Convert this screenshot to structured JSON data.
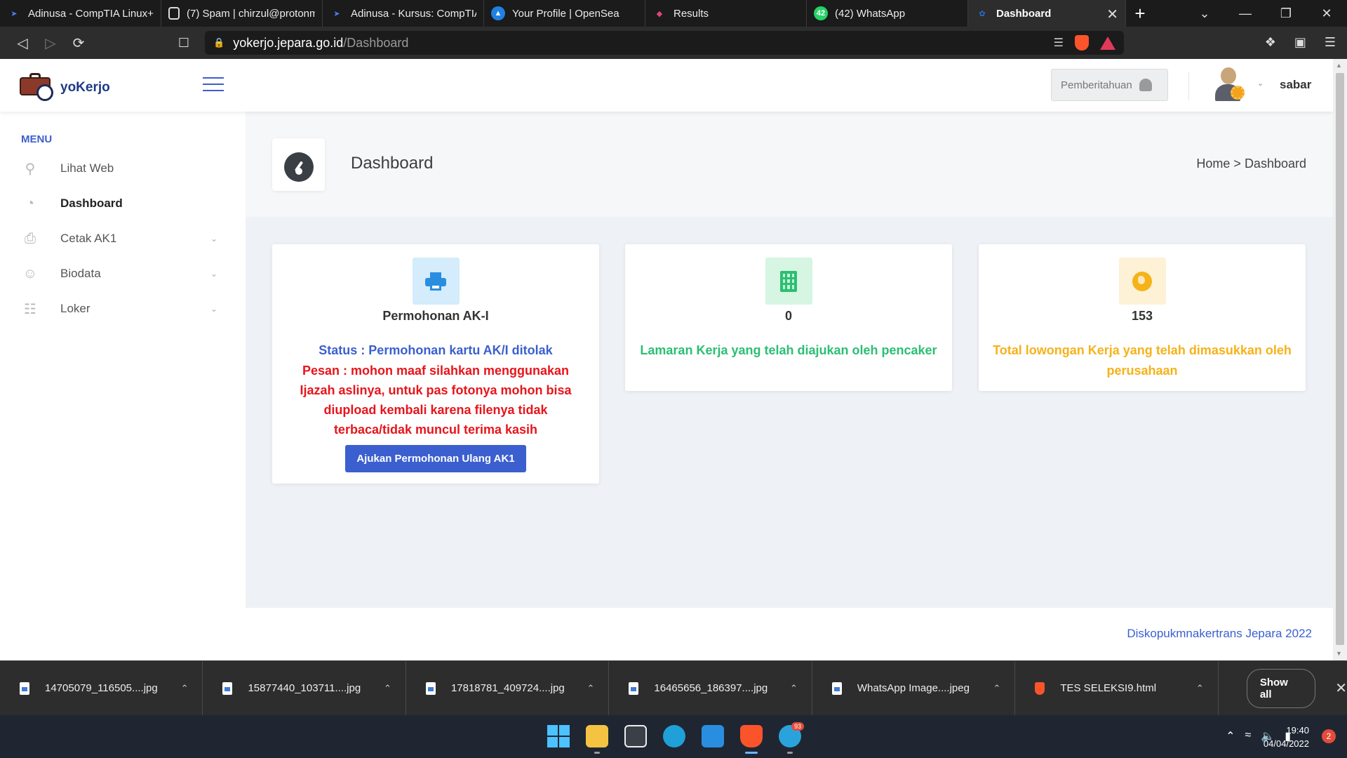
{
  "browser": {
    "tabs": [
      {
        "label": "Adinusa - CompTIA Linux+",
        "icon": "adinusa-icon",
        "active": false
      },
      {
        "label": "(7) Spam | chirzul@protonm",
        "icon": "proton-icon",
        "active": false
      },
      {
        "label": "Adinusa - Kursus: CompTIA",
        "icon": "adinusa-icon",
        "active": false
      },
      {
        "label": "Your Profile | OpenSea",
        "icon": "opensea-icon",
        "active": false
      },
      {
        "label": "Results",
        "icon": "results-icon",
        "active": false
      },
      {
        "label": "(42) WhatsApp",
        "icon": "whatsapp-icon",
        "active": false
      },
      {
        "label": "Dashboard",
        "icon": "yokerjo-icon",
        "active": true
      }
    ],
    "whatsapp_badge": "42",
    "url_host": "yokerjo.jepara.go.id",
    "url_path": "/Dashboard"
  },
  "app": {
    "logo_text": "yoKerjo",
    "notification_label": "Pemberitahuan",
    "username": "sabar"
  },
  "sidebar": {
    "menu_title": "MENU",
    "items": [
      {
        "label": "Lihat Web",
        "icon": "search-icon",
        "active": false,
        "has_submenu": false
      },
      {
        "label": "Dashboard",
        "icon": "pie-chart-icon",
        "active": true,
        "has_submenu": false
      },
      {
        "label": "Cetak AK1",
        "icon": "printer-icon",
        "active": false,
        "has_submenu": true
      },
      {
        "label": "Biodata",
        "icon": "user-icon",
        "active": false,
        "has_submenu": true
      },
      {
        "label": "Loker",
        "icon": "clipboard-icon",
        "active": false,
        "has_submenu": true
      }
    ]
  },
  "header": {
    "title": "Dashboard",
    "breadcrumb_home": "Home",
    "breadcrumb_sep": ">",
    "breadcrumb_current": "Dashboard"
  },
  "cards": {
    "ak1": {
      "title": "Permohonan AK-I",
      "status": "Status : Permohonan kartu AK/I ditolak",
      "message": "Pesan : mohon maaf silahkan menggunakan Ijazah aslinya, untuk pas fotonya mohon bisa diupload kembali karena filenya tidak terbaca/tidak muncul terima kasih",
      "button_label": "Ajukan Permohonan Ulang AK1"
    },
    "applications": {
      "count": "0",
      "description": "Lamaran Kerja yang telah diajukan oleh pencaker"
    },
    "vacancies": {
      "count": "153",
      "description": "Total lowongan Kerja yang telah dimasukkan oleh perusahaan"
    }
  },
  "footer": {
    "text": "Diskopukmnakertrans Jepara 2022"
  },
  "downloads": {
    "items": [
      {
        "name": "14705079_116505....jpg"
      },
      {
        "name": "15877440_103711....jpg"
      },
      {
        "name": "17818781_409724....jpg"
      },
      {
        "name": "16465656_186397....jpg"
      },
      {
        "name": "WhatsApp Image....jpeg"
      },
      {
        "name": "TES SELEKSI9.html"
      }
    ],
    "show_all": "Show all"
  },
  "taskbar": {
    "telegram_badge": "93",
    "time": "19:40",
    "date": "04/04/2022",
    "notification_count": "2"
  },
  "colors": {
    "accent": "#3b5fcf",
    "danger": "#e8141b",
    "success": "#2bbf73",
    "warning": "#f6b21a"
  }
}
